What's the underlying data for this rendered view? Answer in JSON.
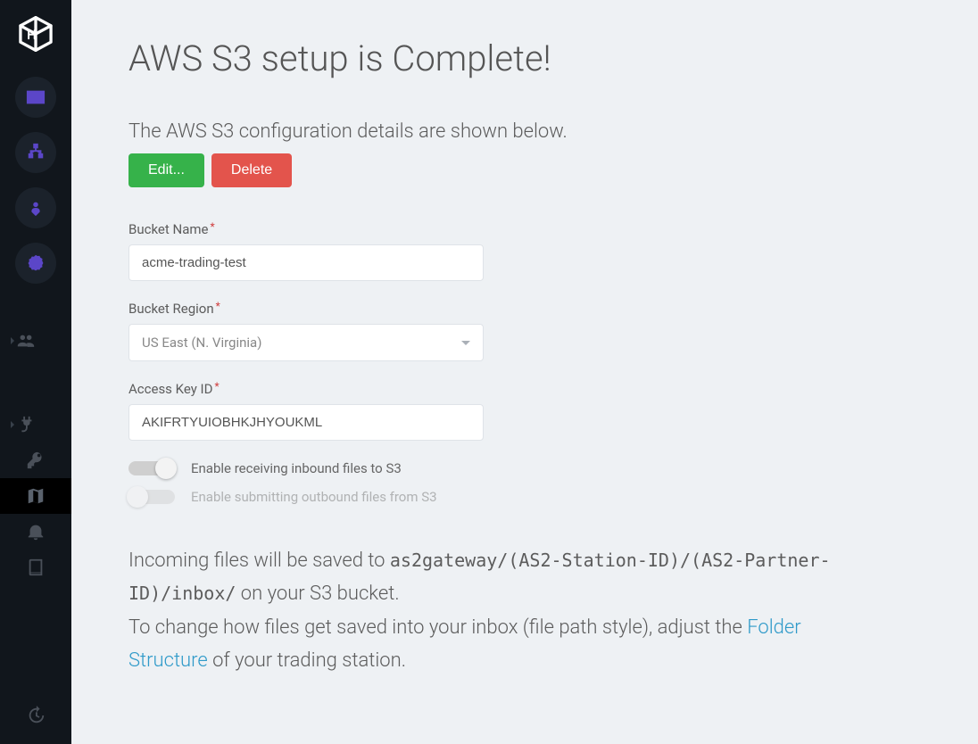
{
  "page": {
    "title": "AWS S3 setup is Complete!",
    "subtitle": "The AWS S3 configuration details are shown below."
  },
  "actions": {
    "edit": "Edit...",
    "delete": "Delete"
  },
  "form": {
    "bucket_name": {
      "label": "Bucket Name",
      "value": "acme-trading-test"
    },
    "bucket_region": {
      "label": "Bucket Region",
      "value": "US East (N. Virginia)"
    },
    "access_key_id": {
      "label": "Access Key ID",
      "value": "AKIFRTYUIOBHKJHYOUKML"
    }
  },
  "toggles": {
    "inbound": {
      "label": "Enable receiving inbound files to S3",
      "on": true
    },
    "outbound": {
      "label": "Enable submitting outbound files from S3",
      "on": false
    }
  },
  "info": {
    "line1_a": "Incoming files will be saved to ",
    "line1_path": "as2gateway/(AS2-Station-ID)/(AS2-Partner-ID)/inbox/",
    "line1_b": " on your S3 bucket.",
    "line2_a": "To change how files get saved into your inbox (file path style), adjust the ",
    "line2_link": "Folder Structure",
    "line2_b": " of your trading station."
  },
  "sidebar": {
    "icons": [
      "envelope",
      "sitemap",
      "user-pin",
      "badge",
      "users",
      "plug",
      "key",
      "map",
      "bell",
      "book",
      "history"
    ]
  }
}
